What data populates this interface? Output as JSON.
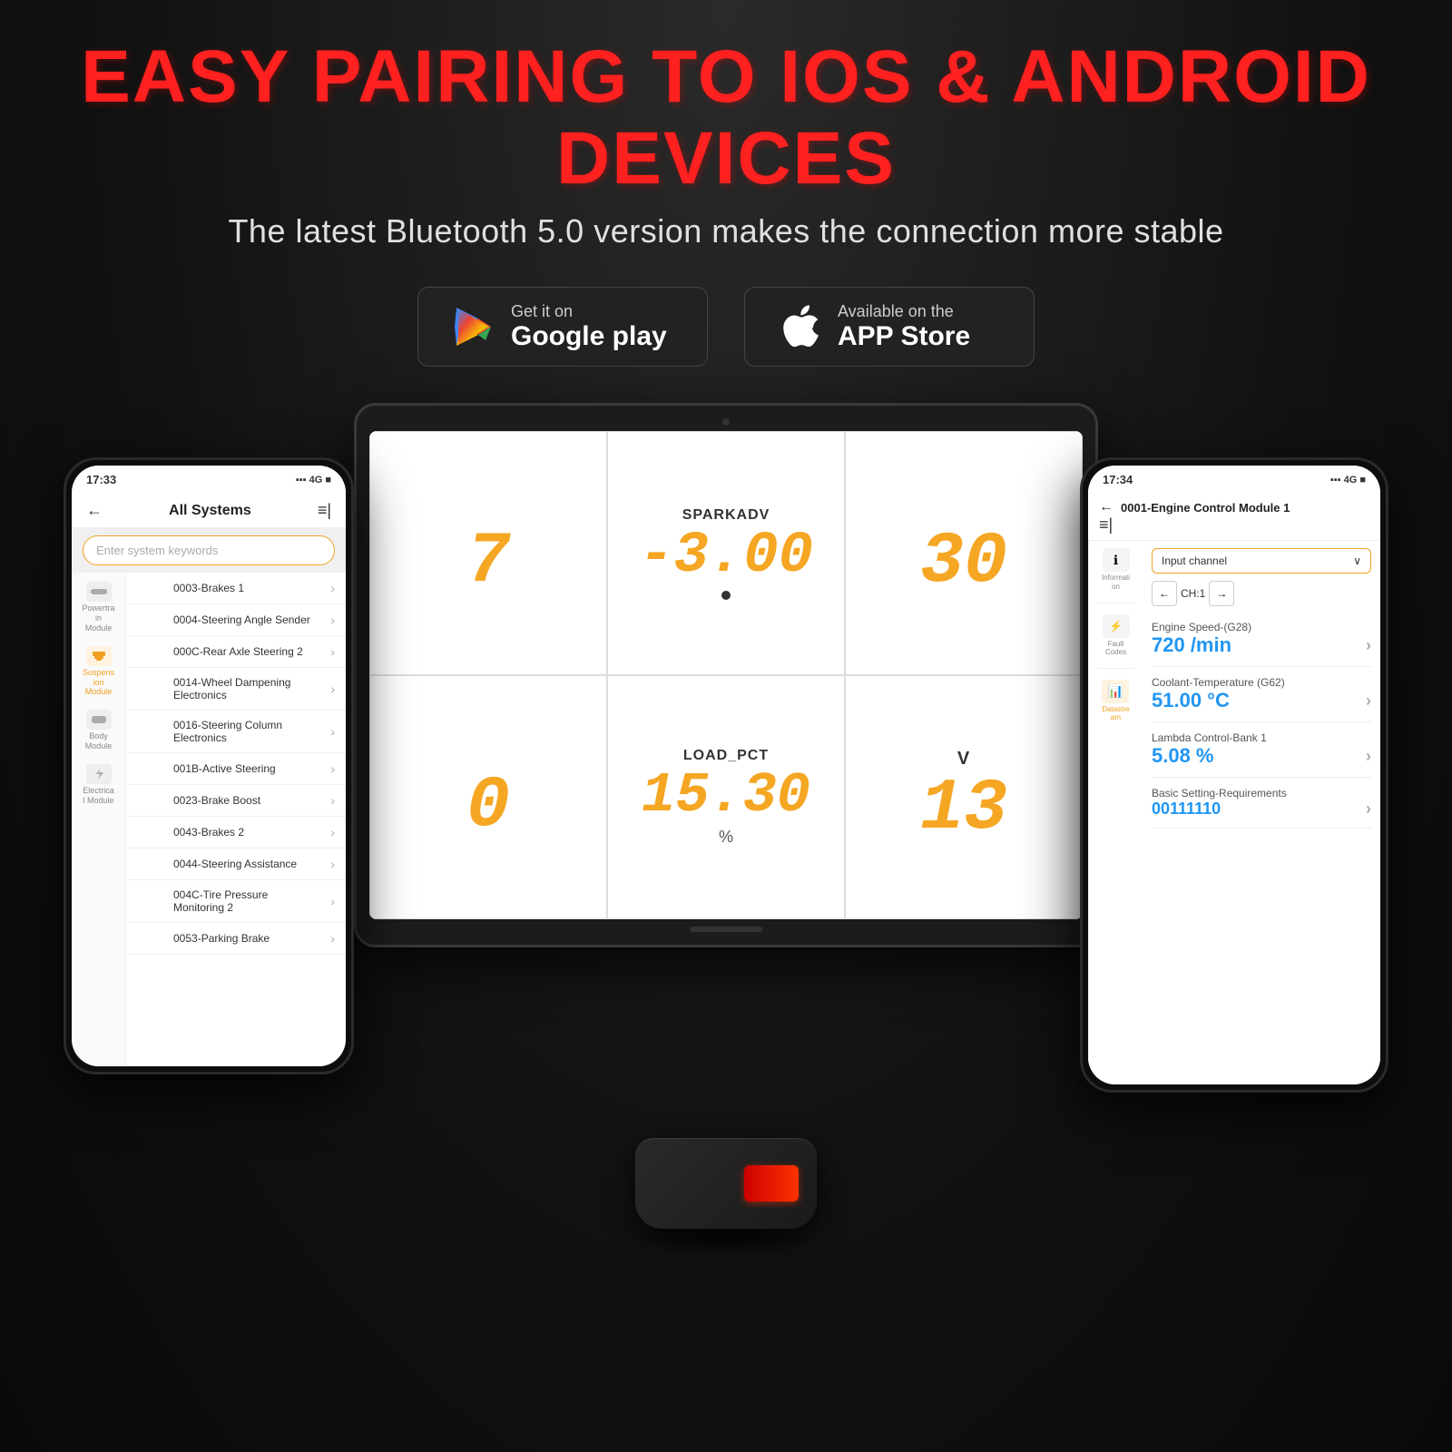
{
  "page": {
    "background": "#1a1a1a"
  },
  "header": {
    "main_title": "EASY PAIRING TO IOS & ANDROID DEVICES",
    "subtitle": "The latest Bluetooth 5.0 version makes the connection more stable"
  },
  "store_buttons": {
    "google_play": {
      "pre_text": "Get it on",
      "main_text": "Google play"
    },
    "app_store": {
      "pre_text": "Available on the",
      "main_text": "APP Store"
    }
  },
  "left_phone": {
    "status_bar": {
      "time": "17:33",
      "signal": "4G"
    },
    "header_title": "All Systems",
    "search_placeholder": "Enter system keywords",
    "modules": [
      {
        "label": "Powertrain Module",
        "items": []
      },
      {
        "label": "Suspension Module",
        "active": true,
        "items": []
      },
      {
        "label": "Body Module",
        "items": []
      },
      {
        "label": "Electrical Module",
        "items": []
      }
    ],
    "list_items": [
      "0003-Brakes 1",
      "0004-Steering Angle Sender",
      "000C-Rear Axle Steering 2",
      "0014-Wheel Dampening Electronics",
      "0016-Steering Column Electronics",
      "001B-Active Steering",
      "0023-Brake Boost",
      "0043-Brakes 2",
      "0044-Steering Assistance",
      "004C-Tire Pressure Monitoring 2",
      "0053-Parking Brake"
    ]
  },
  "tablet": {
    "gauges": [
      {
        "label": "",
        "value": "7",
        "unit": ""
      },
      {
        "label": "SPARKADV",
        "value": "-3.00",
        "unit": "●"
      },
      {
        "label": "",
        "value": "30",
        "unit": ""
      },
      {
        "label": "",
        "value": "0",
        "unit": ""
      },
      {
        "label": "LOAD_PCT",
        "value": "15.30",
        "unit": "%"
      },
      {
        "label": "V",
        "value": "13",
        "unit": ""
      }
    ]
  },
  "right_phone": {
    "status_bar": {
      "time": "17:34",
      "signal": "4G"
    },
    "header_title": "0001-Engine Control Module 1",
    "channel": {
      "label": "Input channel",
      "current": "CH:1"
    },
    "sidebar_items": [
      {
        "icon": "ℹ",
        "label": "Information"
      },
      {
        "icon": "⚠",
        "label": "Fault Codes"
      },
      {
        "icon": "📊",
        "label": "Datastream",
        "active": true
      }
    ],
    "data_items": [
      {
        "label": "Engine Speed-(G28)",
        "value": "720 /min"
      },
      {
        "label": "Coolant-Temperature (G62)",
        "value": "51.00 °C"
      },
      {
        "label": "Lambda Control-Bank 1",
        "value": "5.08 %"
      },
      {
        "label": "Basic Setting-Requirements",
        "value": "00111110"
      }
    ]
  },
  "obd_device": {
    "alt": "OBD Bluetooth Diagnostic Device"
  }
}
